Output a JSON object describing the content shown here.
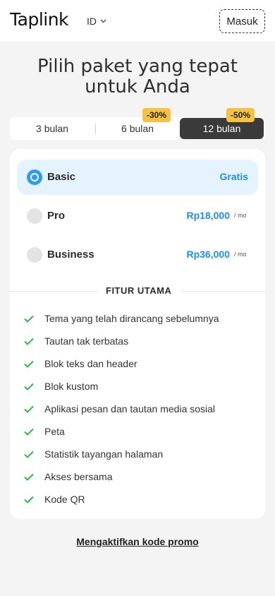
{
  "header": {
    "logo": "Taplink",
    "language": "ID",
    "login_label": "Masuk"
  },
  "hero": {
    "title": "Pilih paket yang tepat untuk Anda"
  },
  "periods": {
    "tabs": [
      {
        "label": "3 bulan",
        "badge": ""
      },
      {
        "label": "6 bulan",
        "badge": "-30%"
      },
      {
        "label": "12 bulan",
        "badge": "-50%"
      }
    ],
    "selected": "12 bulan"
  },
  "plans": [
    {
      "name": "Basic",
      "price": "Gratis",
      "period": "",
      "selected": true
    },
    {
      "name": "Pro",
      "price": "Rp18,000",
      "period": "/ mo",
      "selected": false
    },
    {
      "name": "Business",
      "price": "Rp36,000",
      "period": "/ mo",
      "selected": false
    }
  ],
  "features": {
    "title": "FITUR UTAMA",
    "items": [
      "Tema yang telah dirancang sebelumnya",
      "Tautan tak terbatas",
      "Blok teks dan header",
      "Blok kustom",
      "Aplikasi pesan dan tautan media sosial",
      "Peta",
      "Statistik tayangan halaman",
      "Akses bersama",
      "Kode QR"
    ]
  },
  "promo_label": "Mengaktifkan kode promo",
  "colors": {
    "accent": "#1f8ee0",
    "check": "#2eb84b",
    "badge": "#f5c242",
    "selected_plan_bg": "#e5f3fe",
    "dark_tab": "#3a3a3a"
  }
}
